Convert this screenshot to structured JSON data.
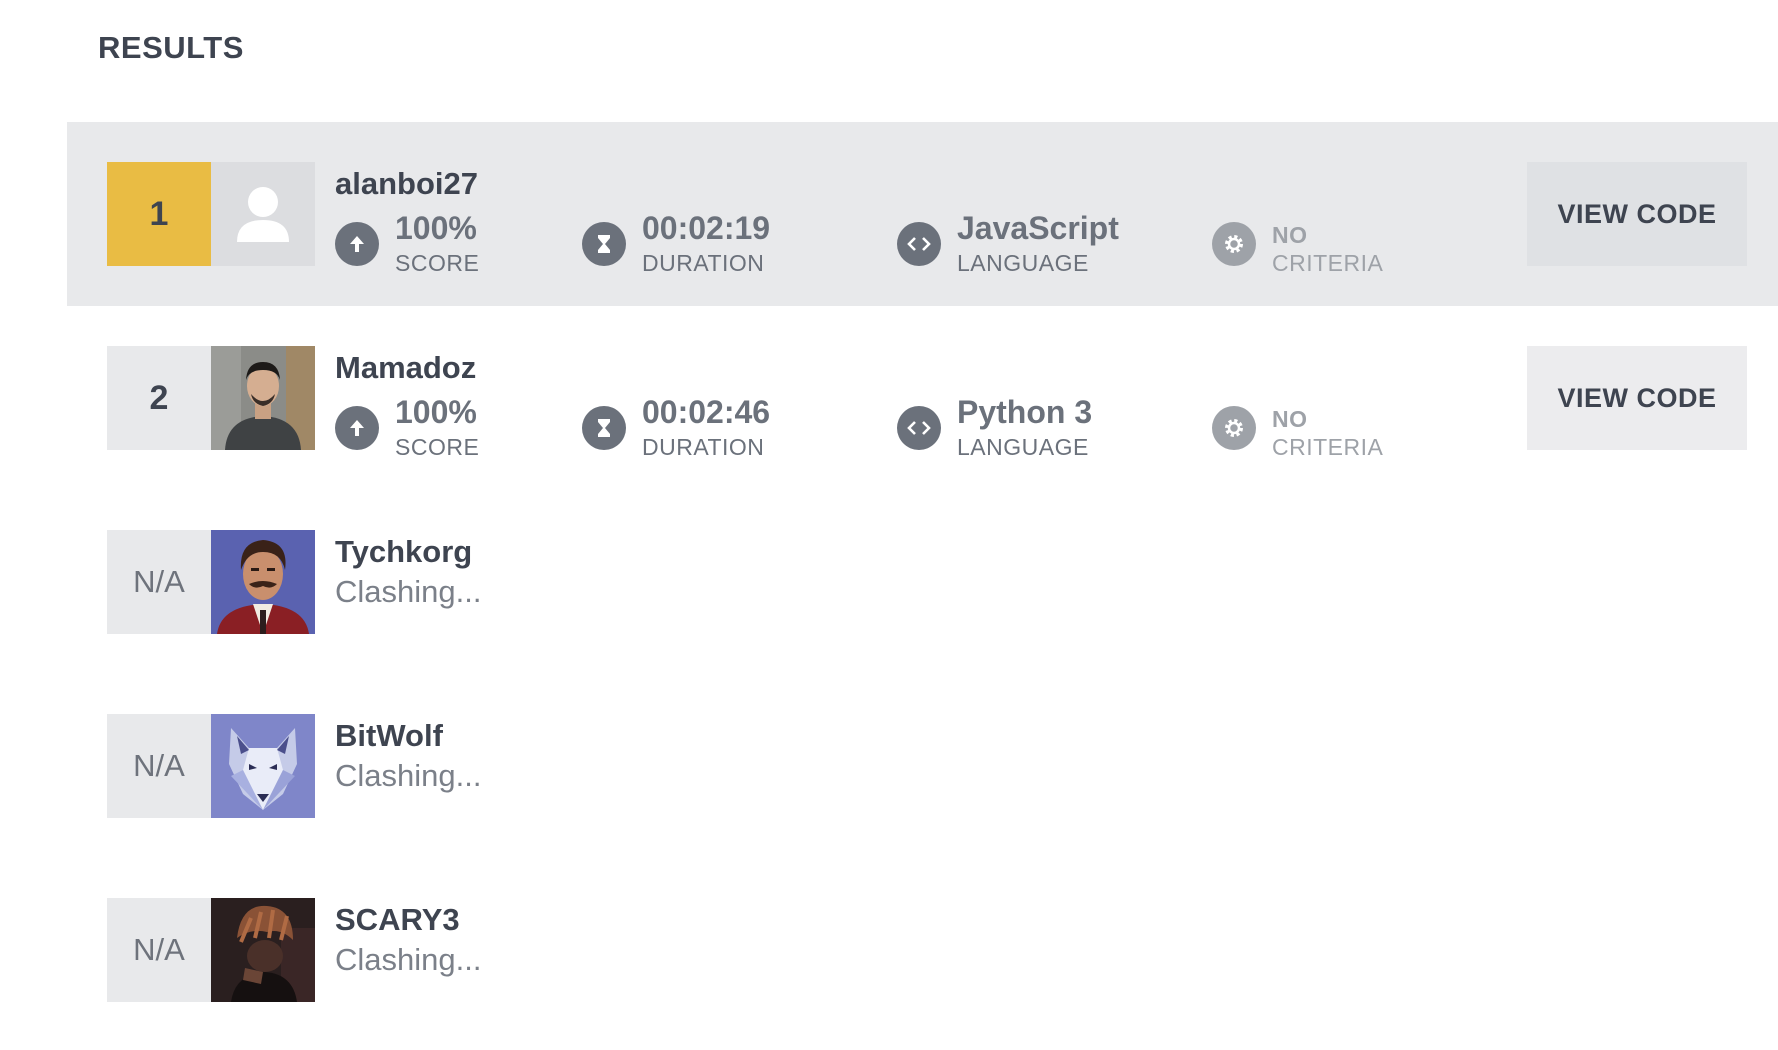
{
  "page": {
    "title": "RESULTS"
  },
  "labels": {
    "score": "SCORE",
    "duration": "DURATION",
    "language": "LANGUAGE",
    "criteria_value": "NO",
    "criteria": "CRITERIA",
    "view_code": "VIEW CODE"
  },
  "results": [
    {
      "rank": "1",
      "name": "alanboi27",
      "score": "100%",
      "duration": "00:02:19",
      "language": "JavaScript",
      "avatar": "default-user-icon"
    },
    {
      "rank": "2",
      "name": "Mamadoz",
      "score": "100%",
      "duration": "00:02:46",
      "language": "Python 3",
      "avatar": "photo-man"
    },
    {
      "rank": "N/A",
      "name": "Tychkorg",
      "status": "Clashing...",
      "avatar": "portrait-mustache"
    },
    {
      "rank": "N/A",
      "name": "BitWolf",
      "status": "Clashing...",
      "avatar": "wolf-art"
    },
    {
      "rank": "N/A",
      "name": "SCARY3",
      "status": "Clashing...",
      "avatar": "dark-figure"
    }
  ],
  "colors": {
    "gold": "#e9bc44",
    "highlight": "#e8e9eb",
    "text": "#3e4450",
    "icon": "#6b717b"
  }
}
